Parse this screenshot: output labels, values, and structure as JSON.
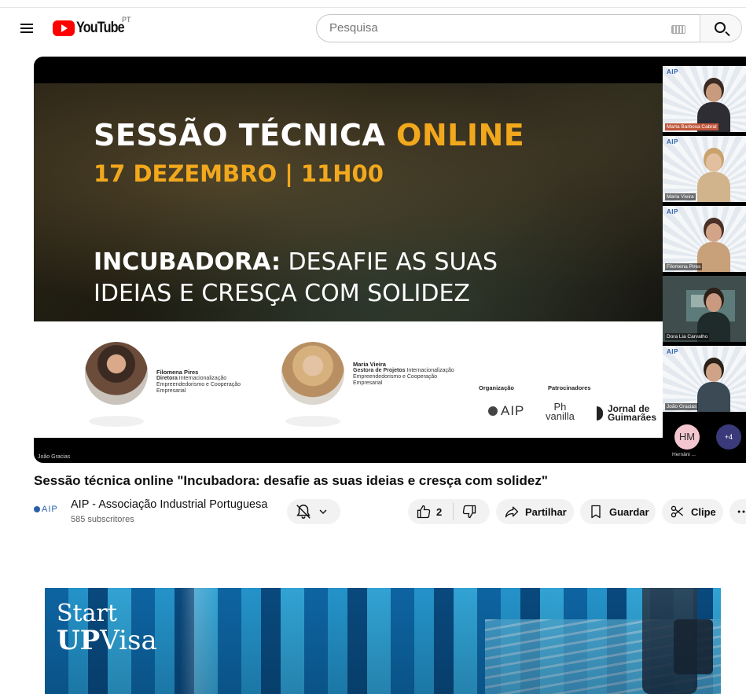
{
  "masthead": {
    "logo_text": "YouTube",
    "country_code": "PT",
    "search_placeholder": "Pesquisa"
  },
  "slide": {
    "headline_white": "SESSÃO TÉCNICA ",
    "headline_accent": "ONLINE",
    "date": "17 DEZEMBRO | 11H00",
    "subtitle_bold": "INCUBADORA:",
    "subtitle_rest": " DESAFIE AS SUAS",
    "subtitle_line2": "IDEIAS E CRESÇA COM SOLIDEZ",
    "speaker1": {
      "name": "Filomena Pires",
      "title_bold": "Diretora",
      "title_rest": " Internacionalização",
      "dept": "Empreendedorismo e Cooperação",
      "dept2": "Empresarial"
    },
    "speaker2": {
      "name": "Maria Vieira",
      "title_bold": "Gestora de Projetos",
      "title_rest": " Internacionalização",
      "dept": "Empreendedorismo e Cooperação",
      "dept2": "Empresarial"
    },
    "organization_label": "Organização",
    "sponsors_label": "Patrocinadores",
    "org_logo": "AIP",
    "sponsor1_line1": "Ph",
    "sponsor1_line2": "vanilla",
    "sponsor2_line1": "Jornal de",
    "sponsor2_line2": "Guimarães",
    "presenter_label": "João Gracias"
  },
  "participants": [
    {
      "name": "Marta Barbosa Cabral",
      "logo": "AIP",
      "skin": "#c89a7e",
      "hair": "#3b2a22",
      "shirt": "#2d2d33",
      "highlight": true
    },
    {
      "name": "Maria Vieira",
      "logo": "AIP",
      "skin": "#e2bf9e",
      "hair": "#c9a26c",
      "shirt": "#d1b48c",
      "highlight": false
    },
    {
      "name": "Filomena Pires",
      "logo": "AIP",
      "skin": "#d4a488",
      "hair": "#4a3026",
      "shirt": "#c8a07a",
      "highlight": false
    },
    {
      "name": "Dora Lia Carvalho",
      "logo": "",
      "skin": "#c99a80",
      "hair": "#2c2018",
      "shirt": "#1f2a2a",
      "highlight": false
    },
    {
      "name": "João Gracias",
      "logo": "AIP",
      "skin": "#d0a387",
      "hair": "#2a2119",
      "shirt": "#3b4a55",
      "highlight": false
    }
  ],
  "avatars": {
    "initials": "HM",
    "more_count": "+4",
    "name": "Hernâni ..."
  },
  "video": {
    "title": "Sessão técnica online \"Incubadora: desafie as suas ideias e cresça com solidez\""
  },
  "channel": {
    "name": "AIP - Associação Industrial Portuguesa",
    "subscribers": "585 subscritores",
    "logo": "AIP"
  },
  "actions": {
    "like_count": "2",
    "share_label": "Partilhar",
    "save_label": "Guardar",
    "clip_label": "Clipe"
  },
  "banner": {
    "line1": "Start",
    "line2_bold": "UP",
    "line2_rest": "Visa"
  },
  "colors": {
    "accent_orange": "#f2a81d",
    "youtube_red": "#ff0000",
    "aip_blue": "#2a5fa8"
  }
}
